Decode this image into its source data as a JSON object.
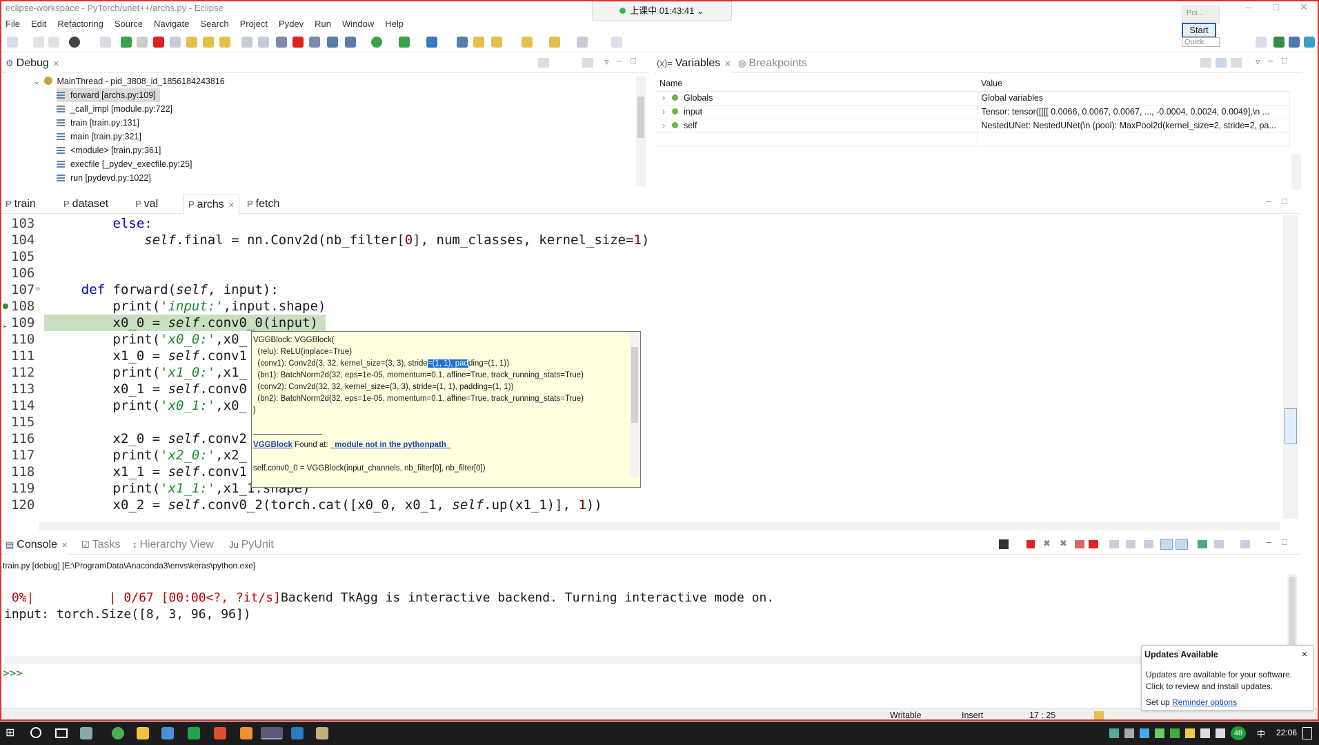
{
  "window": {
    "title": "eclipse-workspace - PyTorch/unet++/archs.py - Eclipse"
  },
  "menu": [
    "File",
    "Edit",
    "Refactoring",
    "Source",
    "Navigate",
    "Search",
    "Project",
    "Pydev",
    "Run",
    "Window",
    "Help"
  ],
  "overlay": {
    "clock": "上课中 01:43:41",
    "popup_label": "Poi...",
    "start_button": "Start",
    "quick_access": "Quick Access"
  },
  "debug": {
    "tab": "Debug",
    "thread": "MainThread - pid_3808_id_1856184243816",
    "frames": [
      "forward [archs.py:109]",
      "_call_impl [module.py:722]",
      "train [train.py:131]",
      "main [train.py:321]",
      "<module> [train.py:361]",
      "execfile [_pydev_execfile.py:25]",
      "run [pydevd.py:1022]"
    ]
  },
  "variables": {
    "tabs": [
      "Variables",
      "Breakpoints"
    ],
    "columns": [
      "Name",
      "Value"
    ],
    "rows": [
      {
        "name": "Globals",
        "value": "Global variables"
      },
      {
        "name": "input",
        "value": "Tensor: tensor([[[[ 0.0066,  0.0067,  0.0067,  ..., -0.0004,  0.0024,  0.0049],\\n    ..."
      },
      {
        "name": "self",
        "value": "NestedUNet: NestedUNet(\\n  (pool): MaxPool2d(kernel_size=2, stride=2, pa..."
      }
    ]
  },
  "editor": {
    "tabs": [
      "train",
      "dataset",
      "val",
      "archs",
      "fetch"
    ],
    "active_tab": "archs",
    "line_numbers": [
      "103",
      "104",
      "105",
      "106",
      "107",
      "108",
      "109",
      "110",
      "111",
      "112",
      "113",
      "114",
      "115",
      "116",
      "117",
      "118",
      "119",
      "120"
    ],
    "code": {
      "l103": "else:",
      "l104a": "self",
      "l104b": ".final = nn.Conv2d(nb_filter[",
      "l104c": "0",
      "l104d": "], num_classes, kernel_size=",
      "l104e": "1",
      "l104f": ")",
      "l107a": "def",
      "l107b": " forward(",
      "l107c": "self",
      "l107d": ", input):",
      "l108a": "print(",
      "l108b": "'input:'",
      "l108c": ",input.shape)",
      "l109a": "x0_0 = ",
      "l109b": "self",
      "l109c": ".conv0_0(input)",
      "l110a": "print(",
      "l110b": "'x0_0:'",
      "l110c": ",x0_",
      "l111a": "x1_0 = ",
      "l111b": "self",
      "l111c": ".conv1",
      "l112a": "print(",
      "l112b": "'x1_0:'",
      "l112c": ",x1_",
      "l113a": "x0_1 = ",
      "l113b": "self",
      "l113c": ".conv0",
      "l114a": "print(",
      "l114b": "'x0_1:'",
      "l114c": ",x0_",
      "l116a": "x2_0 = ",
      "l116b": "self",
      "l116c": ".conv2",
      "l117a": "print(",
      "l117b": "'x2_0:'",
      "l117c": ",x2_",
      "l118a": "x1_1 = ",
      "l118b": "self",
      "l118c": ".conv1",
      "l119a": "print(",
      "l119b": "'x1_1:'",
      "l119c": ",x1_1.shape)",
      "l120a": "x0_2 = ",
      "l120b": "self",
      "l120c": ".conv0_2(torch.cat([x0_0, x0_1, ",
      "l120d": "self",
      "l120e": ".up(x1_1)], ",
      "l120f": "1",
      "l120g": "))"
    }
  },
  "hover": {
    "l1": "VGGBlock: VGGBlock(",
    "l2": "  (relu): ReLU(inplace=True)",
    "l3a": "  (conv1): Conv2d(3, 32, kernel_size=(3, 3), stride",
    "l3b": "=(1, 1), pad",
    "l3c": "ding=(1, 1))",
    "l4": "  (bn1): BatchNorm2d(32, eps=1e-05, momentum=0.1, affine=True, track_running_stats=True)",
    "l5": "  (conv2): Conv2d(32, 32, kernel_size=(3, 3), stride=(1, 1), padding=(1, 1))",
    "l6": "  (bn2): BatchNorm2d(32, eps=1e-05, momentum=0.1, affine=True, track_running_stats=True)",
    "l7": ")",
    "link": "VGGBlock",
    "found": " Found at: ",
    "module": "  module not in the pythonpath  ",
    "source": "self.conv0_0 = VGGBlock(input_channels, nb_filter[0], nb_filter[0])"
  },
  "console": {
    "tabs": [
      "Console",
      "Tasks",
      "Hierarchy View",
      "PyUnit"
    ],
    "path": "train.py [debug] [E:\\ProgramData\\Anaconda3\\envs\\keras\\python.exe]",
    "progress": " 0%|          | 0/67 [00:00<?, ?it/s]",
    "backend": "Backend TkAgg is interactive backend. Turning interactive mode on.",
    "line2": "input: torch.Size([8, 3, 96, 96])",
    "prompt": ">>>"
  },
  "updates": {
    "title": "Updates Available",
    "body": "Updates are available for your software. Click to review and install updates.",
    "setup": "Set up ",
    "link": "Reminder options"
  },
  "status": {
    "writable": "Writable",
    "insert": "Insert",
    "position": "17 : 25"
  },
  "taskbar": {
    "time": "22:06",
    "badge": "48",
    "lang": "中"
  }
}
